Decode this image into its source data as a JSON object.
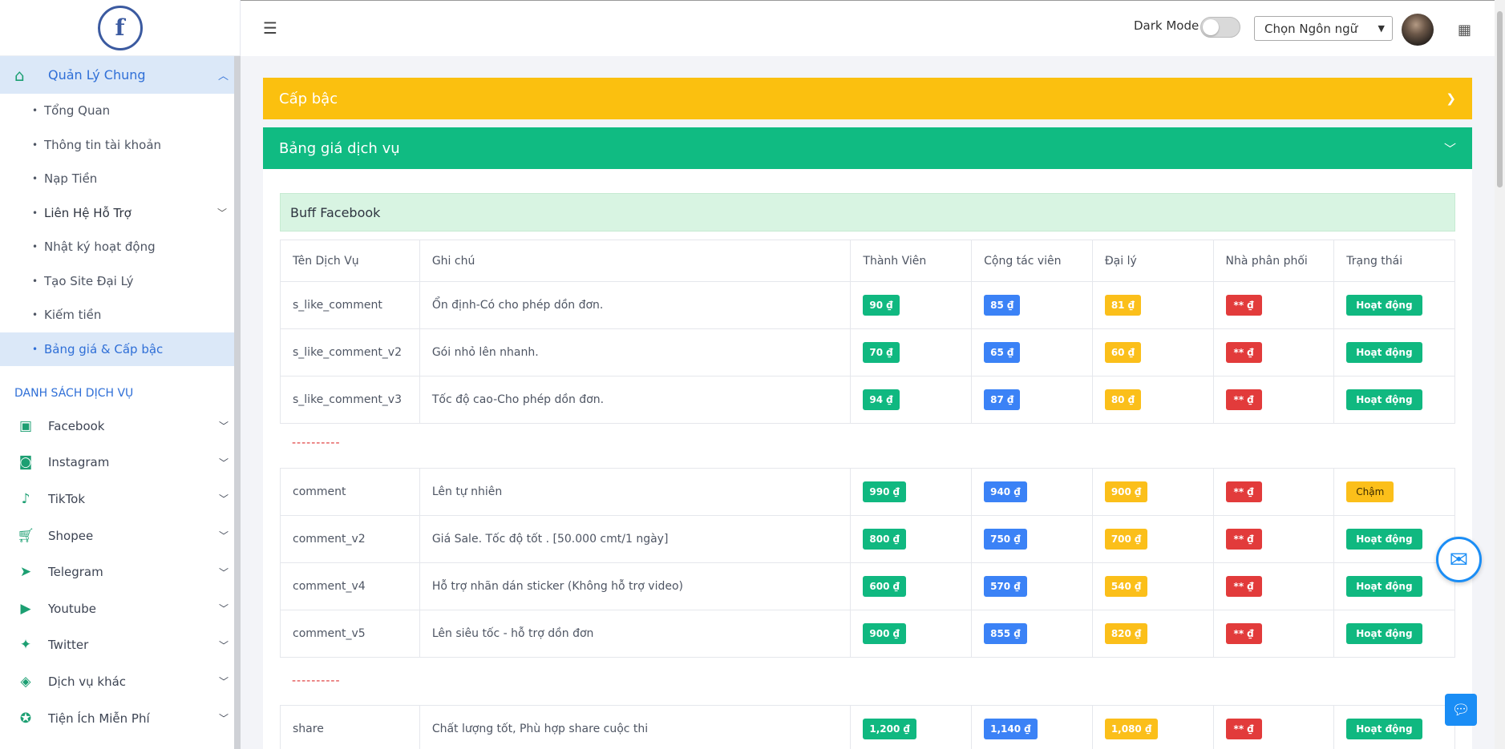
{
  "sidebar": {
    "logo_letter": "f",
    "main_menu": {
      "label": "Quản Lý Chung",
      "icon": "home-icon"
    },
    "sub_items": [
      {
        "label": "Tổng Quan"
      },
      {
        "label": "Thông tin tài khoản"
      },
      {
        "label": "Nạp Tiền"
      },
      {
        "label": "Liên Hệ Hỗ Trợ"
      },
      {
        "label": "Nhật ký hoạt động"
      },
      {
        "label": "Tạo Site Đại Lý"
      },
      {
        "label": "Kiếm tiền"
      },
      {
        "label": "Bảng giá & Cấp bậc"
      }
    ],
    "section_title": "DANH SÁCH DỊCH VỤ",
    "services": [
      {
        "label": "Facebook",
        "icon": "facebook-icon"
      },
      {
        "label": "Instagram",
        "icon": "instagram-icon"
      },
      {
        "label": "TikTok",
        "icon": "tiktok-icon"
      },
      {
        "label": "Shopee",
        "icon": "cart-icon"
      },
      {
        "label": "Telegram",
        "icon": "telegram-icon"
      },
      {
        "label": "Youtube",
        "icon": "youtube-icon"
      },
      {
        "label": "Twitter",
        "icon": "twitter-icon"
      },
      {
        "label": "Dịch vụ khác",
        "icon": "box-icon"
      },
      {
        "label": "Tiện Ích Miễn Phí",
        "icon": "award-icon"
      }
    ]
  },
  "topbar": {
    "dark_mode_label": "Dark Mode",
    "language_select": "Chọn Ngôn ngữ"
  },
  "panels": {
    "rank_title": "Cấp bậc",
    "price_title": "Bảng giá dịch vụ",
    "group_title": "Buff Facebook"
  },
  "table": {
    "headers": [
      "Tên Dịch Vụ",
      "Ghi chú",
      "Thành Viên",
      "Cộng tác viên",
      "Đại lý",
      "Nhà phân phối",
      "Trạng thái"
    ],
    "separator": "----------",
    "rows": [
      {
        "name": "s_like_comment",
        "note": "Ổn định-Có cho phép dồn đơn.",
        "member": "90 ₫",
        "ctv": "85 ₫",
        "agent": "81 ₫",
        "distributor": "** ₫",
        "status": "Hoạt động"
      },
      {
        "name": "s_like_comment_v2",
        "note": "Gói nhỏ lên nhanh.",
        "member": "70 ₫",
        "ctv": "65 ₫",
        "agent": "60 ₫",
        "distributor": "** ₫",
        "status": "Hoạt động"
      },
      {
        "name": "s_like_comment_v3",
        "note": "Tốc độ cao-Cho phép dồn đơn.",
        "member": "94 ₫",
        "ctv": "87 ₫",
        "agent": "80 ₫",
        "distributor": "** ₫",
        "status": "Hoạt động"
      },
      {
        "name": "comment",
        "note": "Lên tự nhiên",
        "member": "990 ₫",
        "ctv": "940 ₫",
        "agent": "900 ₫",
        "distributor": "** ₫",
        "status": "Chậm"
      },
      {
        "name": "comment_v2",
        "note": "Giá Sale. Tốc độ tốt . [50.000 cmt/1 ngày]",
        "member": "800 ₫",
        "ctv": "750 ₫",
        "agent": "700 ₫",
        "distributor": "** ₫",
        "status": "Hoạt động"
      },
      {
        "name": "comment_v4",
        "note": "Hỗ trợ nhãn dán sticker (Không hỗ trợ video)",
        "member": "600 ₫",
        "ctv": "570 ₫",
        "agent": "540 ₫",
        "distributor": "** ₫",
        "status": "Hoạt động"
      },
      {
        "name": "comment_v5",
        "note": "Lên siêu tốc - hỗ trợ dồn đơn",
        "member": "900 ₫",
        "ctv": "855 ₫",
        "agent": "820 ₫",
        "distributor": "** ₫",
        "status": "Hoạt động"
      },
      {
        "name": "share",
        "note": "Chất lượng tốt, Phù hợp share cuộc thi",
        "member": "1,200 ₫",
        "ctv": "1,140 ₫",
        "agent": "1,080 ₫",
        "distributor": "** ₫",
        "status": "Hoạt động"
      }
    ]
  },
  "colors": {
    "primary": "#2f6fd7",
    "green": "#10bb82",
    "yellow": "#fbc00f",
    "red": "#e23b3b",
    "blue": "#3b82f6"
  }
}
